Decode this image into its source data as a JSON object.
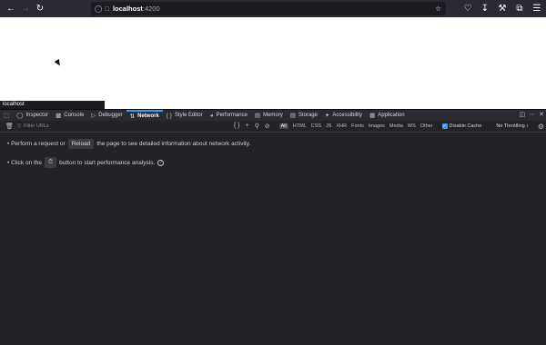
{
  "browser": {
    "url_host": "localhost",
    "url_port": ":4200",
    "hover_label": "localhost"
  },
  "devtools": {
    "tabs": [
      {
        "label": "Inspector",
        "icon": "inspector-icon"
      },
      {
        "label": "Console",
        "icon": "console-icon"
      },
      {
        "label": "Debugger",
        "icon": "debugger-icon"
      },
      {
        "label": "Network",
        "icon": "network-icon",
        "selected": true
      },
      {
        "label": "Style Editor",
        "icon": "style-editor-icon"
      },
      {
        "label": "Performance",
        "icon": "performance-icon"
      },
      {
        "label": "Memory",
        "icon": "memory-icon"
      },
      {
        "label": "Storage",
        "icon": "storage-icon"
      },
      {
        "label": "Accessibility",
        "icon": "accessibility-icon"
      },
      {
        "label": "Application",
        "icon": "application-icon"
      }
    ],
    "filter_placeholder": "Filter URLs",
    "types": [
      "All",
      "HTML",
      "CSS",
      "JS",
      "XHR",
      "Fonts",
      "Images",
      "Media",
      "WS",
      "Other"
    ],
    "disable_cache_label": "Disable Cache",
    "throttling_label": "No Throttling ↕"
  },
  "messages": {
    "line1_a": "• Perform a request or",
    "reload_label": "Reload",
    "line1_b": "the page to see detailed information about network activity.",
    "line2_a": "• Click on the",
    "line2_b": "button to start performance analysis."
  },
  "colors": {
    "devtools_bg": "#232327",
    "toolbar_bg": "#2b2a33",
    "accent": "#3b9dff"
  }
}
